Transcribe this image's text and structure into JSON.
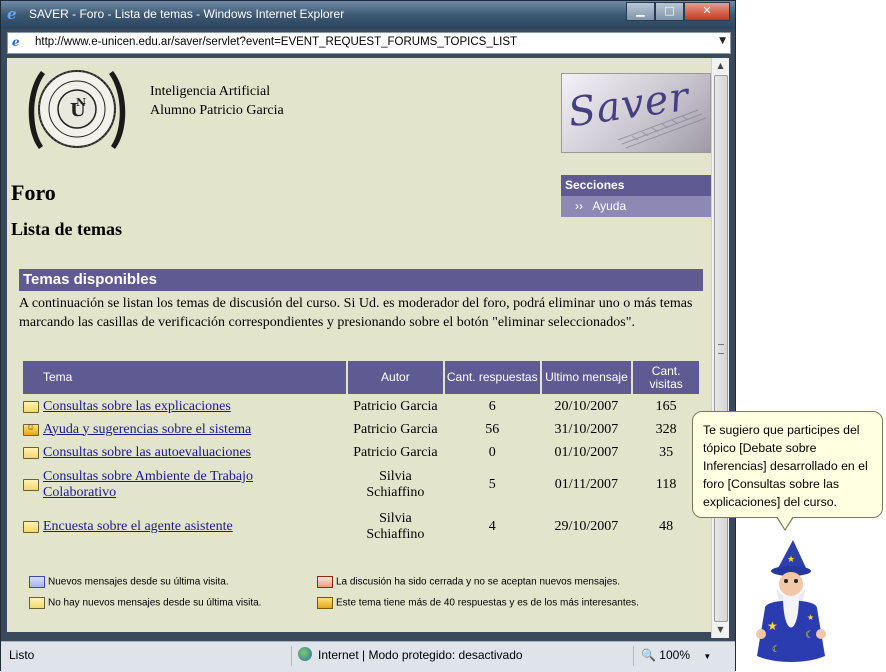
{
  "window": {
    "title": "SAVER - Foro - Lista de temas - Windows Internet Explorer",
    "address": "http://www.e-unicen.edu.ar/saver/servlet?event=EVENT_REQUEST_FORUMS_TOPICS_LIST",
    "buttons": {
      "minimize": "▁",
      "maximize": "□",
      "close": "✕"
    }
  },
  "header": {
    "course": "Inteligencia Artificial",
    "student": "Alumno Patricio Garcia",
    "logo_text": "Saver",
    "seal_text": "UNIVERSIDAD NACIONAL DEL CENTRO DE LA PROVINCIA DE BUENOS AIRES"
  },
  "page": {
    "title": "Foro",
    "subtitle": "Lista de temas"
  },
  "sections": {
    "header": "Secciones",
    "items": [
      {
        "label": "Ayuda",
        "prefix": "››"
      }
    ]
  },
  "topics": {
    "title": "Temas disponibles",
    "intro": "A continuación se listan los temas de discusión del curso. Si Ud. es moderador del foro, podrá eliminar uno o más temas marcando las casillas de verificación correspondientes y presionando sobre el botón \"eliminar seleccionados\".",
    "columns": {
      "tema": "Tema",
      "autor": "Autor",
      "respuestas": "Cant. respuestas",
      "ultimo": "Ultimo mensaje",
      "visitas": "Cant. visitas"
    },
    "rows": [
      {
        "tema": "Consultas sobre las explicaciones",
        "autor": "Patricio Garcia",
        "respuestas": "6",
        "ultimo": "20/10/2007",
        "visitas": "165",
        "icon": "folder-icon"
      },
      {
        "tema": "Ayuda y sugerencias sobre el sistema",
        "autor": "Patricio Garcia",
        "respuestas": "56",
        "ultimo": "31/10/2007",
        "visitas": "328",
        "icon": "hot-folder-icon"
      },
      {
        "tema": "Consultas sobre las autoevaluaciones",
        "autor": "Patricio Garcia",
        "respuestas": "0",
        "ultimo": "01/10/2007",
        "visitas": "35",
        "icon": "folder-icon"
      },
      {
        "tema": "Consultas sobre Ambiente de Trabajo Colaborativo",
        "autor": "Silvia Schiaffino",
        "respuestas": "5",
        "ultimo": "01/11/2007",
        "visitas": "118",
        "icon": "folder-icon"
      },
      {
        "tema": "Encuesta sobre el agente asistente",
        "autor": "Silvia Schiaffino",
        "respuestas": "4",
        "ultimo": "29/10/2007",
        "visitas": "48",
        "icon": "folder-icon"
      }
    ]
  },
  "legend": {
    "new": "Nuevos mensajes desde su última visita.",
    "none": "No hay nuevos mensajes desde su última visita.",
    "closed": "La discusión ha sido cerrada y no se aceptan nuevos mensajes.",
    "hot": "Este tema tiene más de 40 respuestas y es de los más interesantes."
  },
  "status": {
    "left": "Listo",
    "zone": "Internet | Modo protegido: desactivado",
    "zoom": "100%"
  },
  "agent": {
    "message": "Te sugiero que participes del tópico [Debate sobre Inferencias] desarrollado en el foro [Consultas sobre las explicaciones] del curso."
  },
  "colors": {
    "page_bg": "#e3e4cc",
    "header_purple": "#5f5b92",
    "link": "#1a1a8c"
  }
}
